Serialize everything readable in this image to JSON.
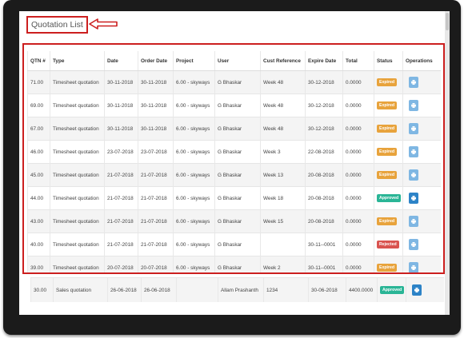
{
  "page": {
    "title": "Quotation List"
  },
  "colors": {
    "expired": "#e8a33c",
    "approved": "#2ab596",
    "rejected": "#d9534f",
    "op_light": "#7fb7e3",
    "op_dark": "#2d83c7",
    "highlight": "#cc1f1f"
  },
  "table": {
    "columns": [
      "QTN #",
      "Type",
      "Date",
      "Order Date",
      "Project",
      "User",
      "Cust Reference",
      "Expire Date",
      "Total",
      "Status",
      "Operations"
    ],
    "rows": [
      {
        "qtn": "71.00",
        "type": "Timesheet quotation",
        "date": "30-11-2018",
        "order_date": "30-11-2018",
        "project": "6.00 - skyways",
        "user": "G Bhaskar",
        "cust_ref": "Week 48",
        "expire": "30-12-2018",
        "total": "0.0000",
        "status": "Expired",
        "status_color": "#e8a33c",
        "op_color": "#7fb7e3"
      },
      {
        "qtn": "69.00",
        "type": "Timesheet quotation",
        "date": "30-11-2018",
        "order_date": "30-11-2018",
        "project": "6.00 - skyways",
        "user": "G Bhaskar",
        "cust_ref": "Week 48",
        "expire": "30-12-2018",
        "total": "0.0000",
        "status": "Expired",
        "status_color": "#e8a33c",
        "op_color": "#7fb7e3"
      },
      {
        "qtn": "67.00",
        "type": "Timesheet quotation",
        "date": "30-11-2018",
        "order_date": "30-11-2018",
        "project": "6.00 - skyways",
        "user": "G Bhaskar",
        "cust_ref": "Week 48",
        "expire": "30-12-2018",
        "total": "0.0000",
        "status": "Expired",
        "status_color": "#e8a33c",
        "op_color": "#7fb7e3"
      },
      {
        "qtn": "46.00",
        "type": "Timesheet quotation",
        "date": "23-07-2018",
        "order_date": "23-07-2018",
        "project": "6.00 - skyways",
        "user": "G Bhaskar",
        "cust_ref": "Week 3",
        "expire": "22-08-2018",
        "total": "0.0000",
        "status": "Expired",
        "status_color": "#e8a33c",
        "op_color": "#7fb7e3"
      },
      {
        "qtn": "45.00",
        "type": "Timesheet quotation",
        "date": "21-07-2018",
        "order_date": "21-07-2018",
        "project": "6.00 - skyways",
        "user": "G Bhaskar",
        "cust_ref": "Week 13",
        "expire": "20-08-2018",
        "total": "0.0000",
        "status": "Expired",
        "status_color": "#e8a33c",
        "op_color": "#7fb7e3"
      },
      {
        "qtn": "44.00",
        "type": "Timesheet quotation",
        "date": "21-07-2018",
        "order_date": "21-07-2018",
        "project": "6.00 - skyways",
        "user": "G Bhaskar",
        "cust_ref": "Week 18",
        "expire": "20-08-2018",
        "total": "0.0000",
        "status": "Approved",
        "status_color": "#2ab596",
        "op_color": "#2d83c7"
      },
      {
        "qtn": "43.00",
        "type": "Timesheet quotation",
        "date": "21-07-2018",
        "order_date": "21-07-2018",
        "project": "6.00 - skyways",
        "user": "G Bhaskar",
        "cust_ref": "Week 15",
        "expire": "20-08-2018",
        "total": "0.0000",
        "status": "Expired",
        "status_color": "#e8a33c",
        "op_color": "#7fb7e3"
      },
      {
        "qtn": "40.00",
        "type": "Timesheet quotation",
        "date": "21-07-2018",
        "order_date": "21-07-2018",
        "project": "6.00 - skyways",
        "user": "G Bhaskar",
        "cust_ref": "",
        "expire": "30-11--0001",
        "total": "0.0000",
        "status": "Rejected",
        "status_color": "#d9534f",
        "op_color": "#7fb7e3"
      },
      {
        "qtn": "39.00",
        "type": "Timesheet quotation",
        "date": "20-07-2018",
        "order_date": "20-07-2018",
        "project": "6.00 - skyways",
        "user": "G Bhaskar",
        "cust_ref": "Week 2",
        "expire": "30-11--0001",
        "total": "0.0000",
        "status": "Expired",
        "status_color": "#e8a33c",
        "op_color": "#7fb7e3"
      }
    ],
    "outer_rows": [
      {
        "qtn": "30.00",
        "type": "Sales quotation",
        "date": "26-06-2018",
        "order_date": "26-06-2018",
        "project": "",
        "user": "Allam Prashanth",
        "cust_ref": "1234",
        "expire": "30-06-2018",
        "total": "4400.0000",
        "status": "Approved",
        "status_color": "#2ab596",
        "op_color": "#2d83c7"
      }
    ]
  },
  "icons": {
    "operation": "print-icon",
    "annotation": "left-arrow-icon"
  }
}
